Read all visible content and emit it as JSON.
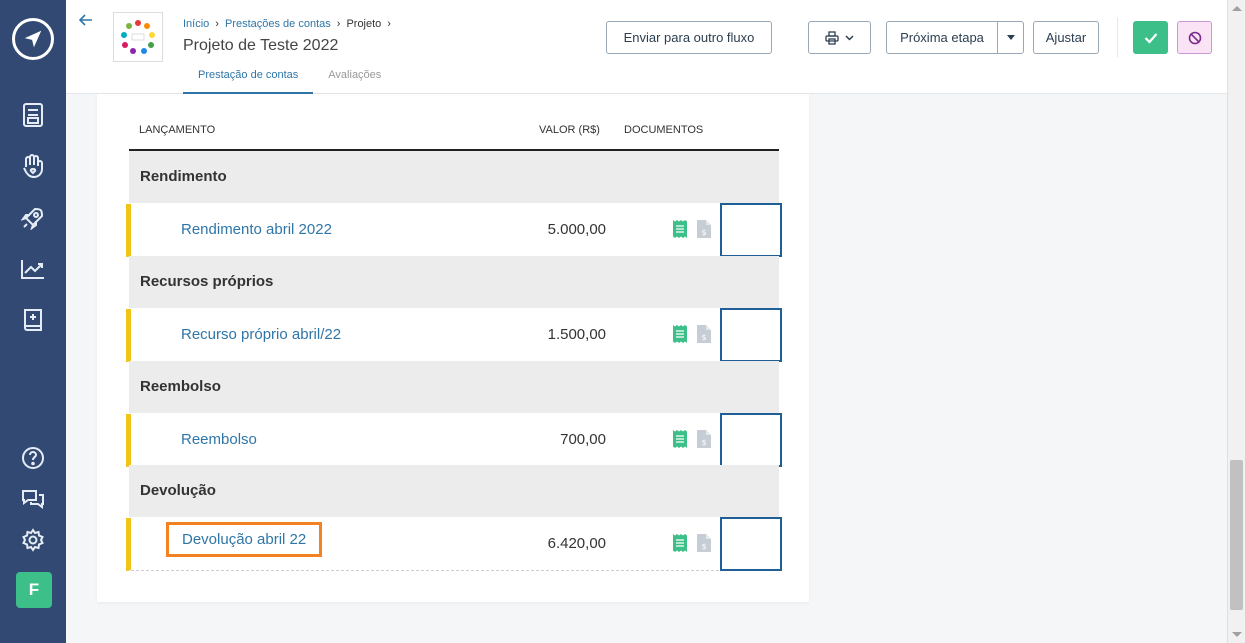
{
  "sidebar": {
    "avatar_letter": "F",
    "icons": [
      "logo-icon",
      "document-icon",
      "hand-heart-icon",
      "rocket-icon",
      "chart-icon",
      "book-icon",
      "help-icon",
      "chat-icon",
      "gear-icon"
    ]
  },
  "header": {
    "breadcrumb": [
      "Início",
      "Prestações de contas",
      "Projeto"
    ],
    "title": "Projeto de Teste 2022",
    "tabs": [
      "Prestação de contas",
      "Avaliações"
    ],
    "active_tab": 0,
    "buttons": {
      "send": "Enviar para outro fluxo",
      "next": "Próxima etapa",
      "adjust": "Ajustar"
    }
  },
  "table": {
    "headers": {
      "launch": "LANÇAMENTO",
      "value": "VALOR (R$)",
      "docs": "DOCUMENTOS"
    },
    "groups": [
      {
        "name": "Rendimento",
        "item": {
          "label": "Rendimento abril 2022",
          "value": "5.000,00"
        }
      },
      {
        "name": "Recursos próprios",
        "item": {
          "label": "Recurso próprio abril/22",
          "value": "1.500,00"
        }
      },
      {
        "name": "Reembolso",
        "item": {
          "label": "Reembolso",
          "value": "700,00"
        }
      },
      {
        "name": "Devolução",
        "item": {
          "label": "Devolução abril 22",
          "value": "6.420,00"
        }
      }
    ]
  },
  "colors": {
    "sidebar": "#324a73",
    "accent_blue": "#2f76a8",
    "accent_green": "#3dbf8a",
    "highlight_orange": "#f58220",
    "row_marker_yellow": "#f0c419"
  }
}
